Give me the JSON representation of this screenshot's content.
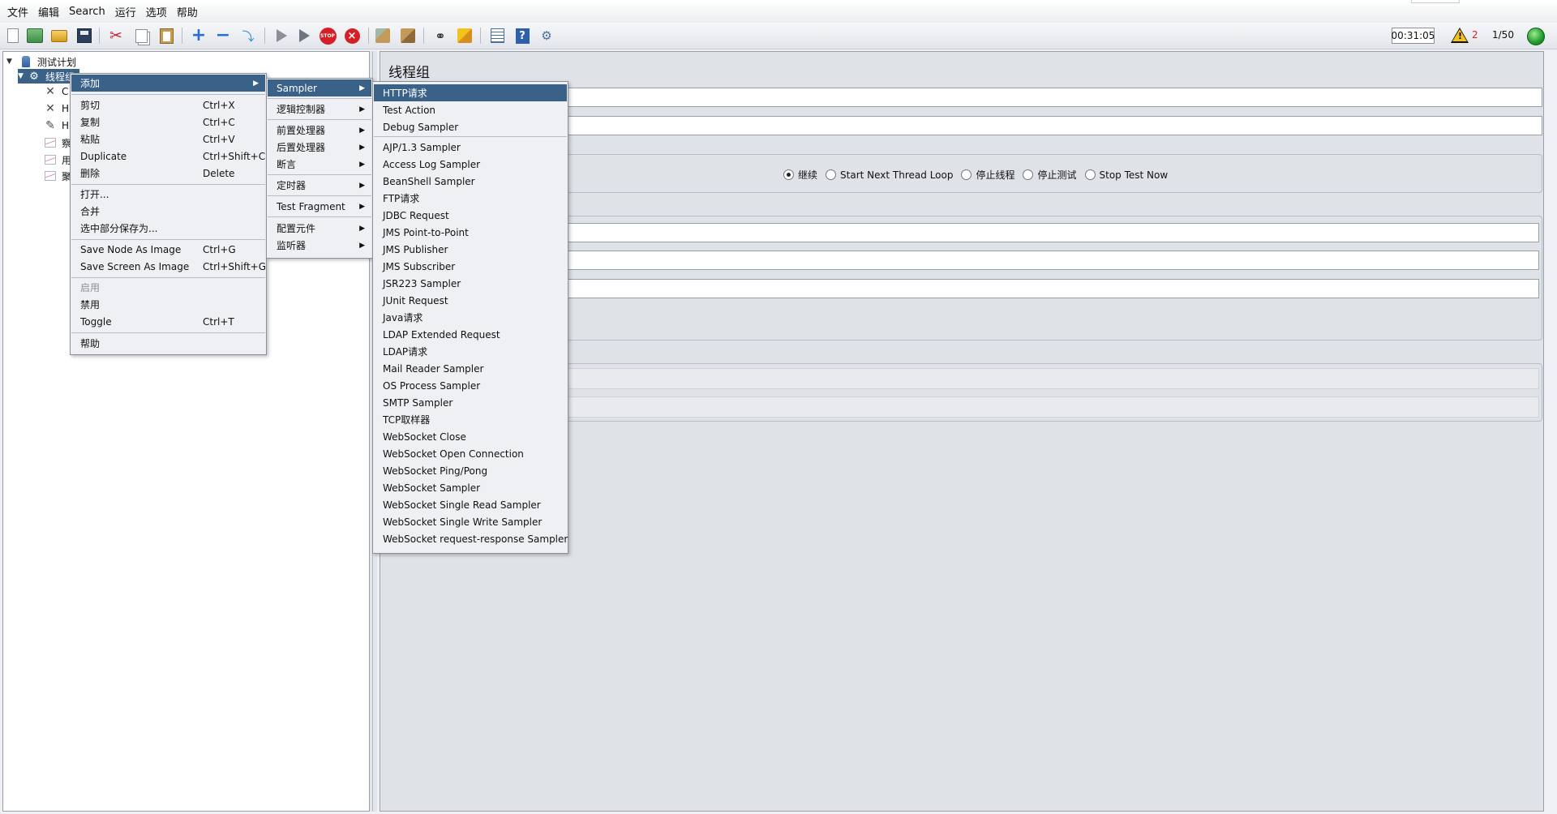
{
  "menubar": {
    "items": [
      "文件",
      "编辑",
      "Search",
      "运行",
      "选项",
      "帮助"
    ]
  },
  "status": {
    "timer": "00:31:05",
    "warning_count": "2",
    "threads": "1/50"
  },
  "tree": {
    "plan_label": "测试计划",
    "thread_group_label": "线程组",
    "children_partial": [
      "C",
      "H",
      "H",
      "察",
      "用",
      "聚"
    ]
  },
  "right_panel": {
    "title": "线程组",
    "radio_options": [
      {
        "label": "继续",
        "checked": true
      },
      {
        "label": "Start Next Thread Loop",
        "checked": false
      },
      {
        "label": "停止线程",
        "checked": false
      },
      {
        "label": "停止测试",
        "checked": false
      },
      {
        "label": "Stop Test Now",
        "checked": false
      }
    ]
  },
  "context_menu": {
    "items": [
      {
        "label": "添加",
        "shortcut": "",
        "submenu": true,
        "active": true
      },
      {
        "label": "剪切",
        "shortcut": "Ctrl+X"
      },
      {
        "label": "复制",
        "shortcut": "Ctrl+C"
      },
      {
        "label": "粘贴",
        "shortcut": "Ctrl+V"
      },
      {
        "label": "Duplicate",
        "shortcut": "Ctrl+Shift+C"
      },
      {
        "label": "删除",
        "shortcut": "Delete"
      },
      {
        "label": "打开...",
        "shortcut": ""
      },
      {
        "label": "合并",
        "shortcut": ""
      },
      {
        "label": "选中部分保存为...",
        "shortcut": ""
      },
      {
        "label": "Save Node As Image",
        "shortcut": "Ctrl+G"
      },
      {
        "label": "Save Screen As Image",
        "shortcut": "Ctrl+Shift+G"
      },
      {
        "label": "启用",
        "shortcut": "",
        "disabled": true
      },
      {
        "label": "禁用",
        "shortcut": ""
      },
      {
        "label": "Toggle",
        "shortcut": "Ctrl+T"
      },
      {
        "label": "帮助",
        "shortcut": ""
      }
    ]
  },
  "add_submenu": {
    "items": [
      {
        "label": "Sampler",
        "active": true
      },
      {
        "label": "逻辑控制器"
      },
      {
        "label": "前置处理器"
      },
      {
        "label": "后置处理器"
      },
      {
        "label": "断言"
      },
      {
        "label": "定时器"
      },
      {
        "label": "Test Fragment"
      },
      {
        "label": "配置元件"
      },
      {
        "label": "监听器"
      }
    ]
  },
  "sampler_submenu": {
    "items": [
      "HTTP请求",
      "Test Action",
      "Debug Sampler",
      "AJP/1.3 Sampler",
      "Access Log Sampler",
      "BeanShell Sampler",
      "FTP请求",
      "JDBC Request",
      "JMS Point-to-Point",
      "JMS Publisher",
      "JMS Subscriber",
      "JSR223 Sampler",
      "JUnit Request",
      "Java请求",
      "LDAP Extended Request",
      "LDAP请求",
      "Mail Reader Sampler",
      "OS Process Sampler",
      "SMTP Sampler",
      "TCP取样器",
      "WebSocket Close",
      "WebSocket Open Connection",
      "WebSocket Ping/Pong",
      "WebSocket Sampler",
      "WebSocket Single Read Sampler",
      "WebSocket Single Write Sampler",
      "WebSocket request-response Sampler"
    ]
  },
  "toolbar_icons": [
    "new-icon",
    "templates-icon",
    "open-icon",
    "save-icon",
    "cut-icon",
    "copy-icon",
    "paste-icon",
    "expand-icon",
    "collapse-icon",
    "toggle-icon",
    "start-icon",
    "start-no-timers-icon",
    "stop-icon",
    "shutdown-icon",
    "clear-icon",
    "clear-all-icon",
    "search-icon",
    "reset-search-icon",
    "function-helper-icon",
    "help-icon",
    "remote-icon"
  ],
  "colors": {
    "selection": "#3a6187",
    "stop_red": "#d51f26",
    "running_green": "#1f9a2c"
  }
}
